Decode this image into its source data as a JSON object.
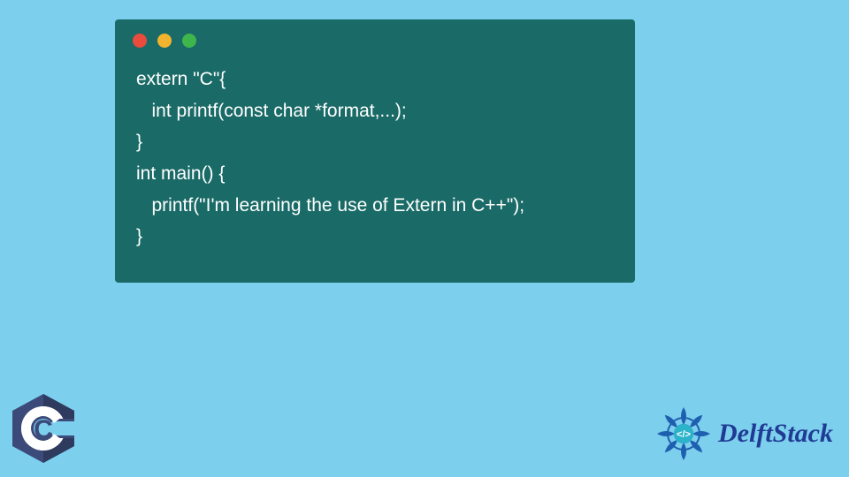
{
  "code": {
    "line1": "extern \"C\"{",
    "line2": "   int printf(const char *format,...);",
    "line3": "}",
    "line4": "int main() {",
    "line5": "   printf(\"I'm learning the use of Extern in C++\");",
    "line6": "}"
  },
  "dots": {
    "red": "#e94b3c",
    "yellow": "#f2b42f",
    "green": "#3fb64b"
  },
  "logo_letter": "C",
  "brand": "DelftStack",
  "colors": {
    "bg": "#7ccfed",
    "window": "#1a6b67",
    "brand_text": "#1f3b94"
  }
}
